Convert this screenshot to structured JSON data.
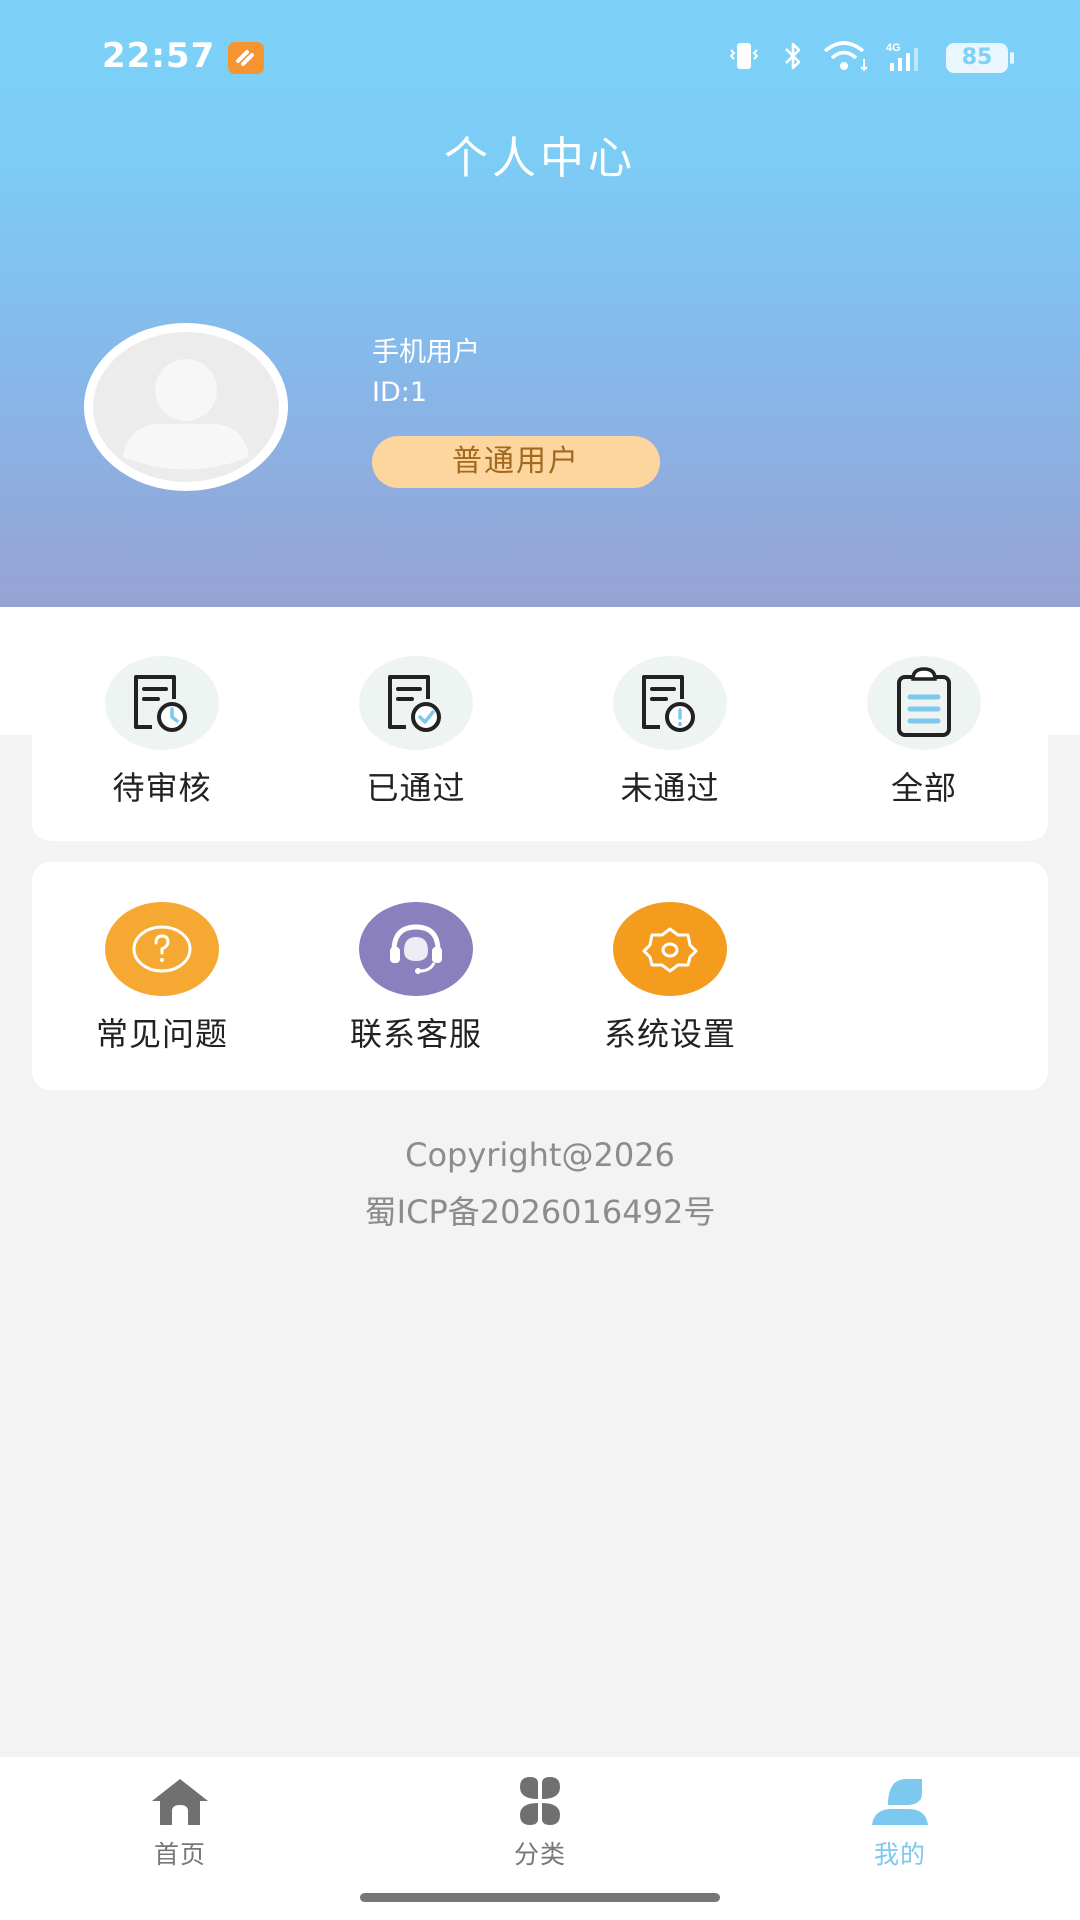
{
  "status_bar": {
    "time": "22:57",
    "battery": "85",
    "icons": [
      "app-notification-icon",
      "vibrate-icon",
      "bluetooth-icon",
      "wifi-icon",
      "signal-4g-icon",
      "battery-icon"
    ]
  },
  "header": {
    "title": "个人中心",
    "user_name": "手机用户",
    "user_id": "ID:1",
    "role": "普通用户"
  },
  "orders": [
    {
      "label": "待审核",
      "icon": "pending-review-icon"
    },
    {
      "label": "已通过",
      "icon": "approved-icon"
    },
    {
      "label": "未通过",
      "icon": "rejected-icon"
    },
    {
      "label": "全部",
      "icon": "all-clipboard-icon"
    }
  ],
  "services": [
    {
      "label": "常见问题",
      "icon": "faq-icon"
    },
    {
      "label": "联系客服",
      "icon": "customer-service-icon"
    },
    {
      "label": "系统设置",
      "icon": "settings-icon"
    }
  ],
  "footer": {
    "copyright": "Copyright@2026",
    "icp": "蜀ICP备2026016492号"
  },
  "tabbar": {
    "items": [
      {
        "label": "首页",
        "icon": "home-icon",
        "active": false
      },
      {
        "label": "分类",
        "icon": "category-icon",
        "active": false
      },
      {
        "label": "我的",
        "icon": "profile-icon",
        "active": true
      }
    ]
  },
  "colors": {
    "header_top": "#7dd1f8",
    "header_bottom": "#97a2d4",
    "badge_bg": "#fcd59f",
    "badge_text": "#a3691f",
    "accent_active": "#7cc8ef",
    "faq": "#f5a832",
    "service": "#8a80bd",
    "settings": "#f39c1e"
  }
}
